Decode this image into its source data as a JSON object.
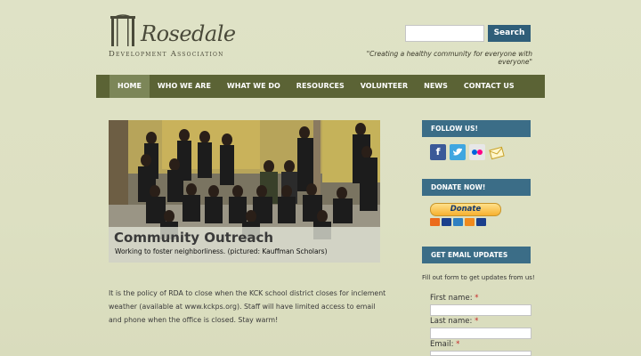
{
  "header": {
    "logo_name": "Rosedale",
    "logo_subtitle": "Development Association",
    "tagline": "\"Creating a healthy community for everyone with everyone\""
  },
  "search": {
    "placeholder": "",
    "button_label": "Search"
  },
  "nav": {
    "items": [
      "HOME",
      "WHO WE ARE",
      "WHAT WE DO",
      "RESOURCES",
      "VOLUNTEER",
      "NEWS",
      "CONTACT US"
    ],
    "active_index": 0
  },
  "hero": {
    "title": "Community Outreach",
    "subtitle": "Working to foster neighborliness. (pictured: Kauffman Scholars)"
  },
  "main": {
    "policy_text": "It is the policy of RDA to close when the KCK school district closes for inclement weather (available at www.kckps.org). Staff will have limited access to email and phone when the office is closed.  Stay warm!"
  },
  "sidebar": {
    "follow": {
      "header": "FOLLOW US!",
      "icons": [
        "facebook-icon",
        "twitter-icon",
        "flickr-icon",
        "email-icon"
      ]
    },
    "donate": {
      "header": "DONATE NOW!",
      "button_label": "Donate"
    },
    "email": {
      "header": "GET EMAIL UPDATES",
      "intro": "Fill out form to get updates from us!",
      "fields": [
        {
          "label": "First name:",
          "required_mark": "*"
        },
        {
          "label": "Last name:",
          "required_mark": "*"
        },
        {
          "label": "Email:",
          "required_mark": "*"
        }
      ]
    }
  },
  "colors": {
    "nav_bg": "#5b6335",
    "nav_active": "#7c8658",
    "widget_header": "#3b6d87",
    "search_button": "#2f5e79",
    "required": "#c62828"
  }
}
